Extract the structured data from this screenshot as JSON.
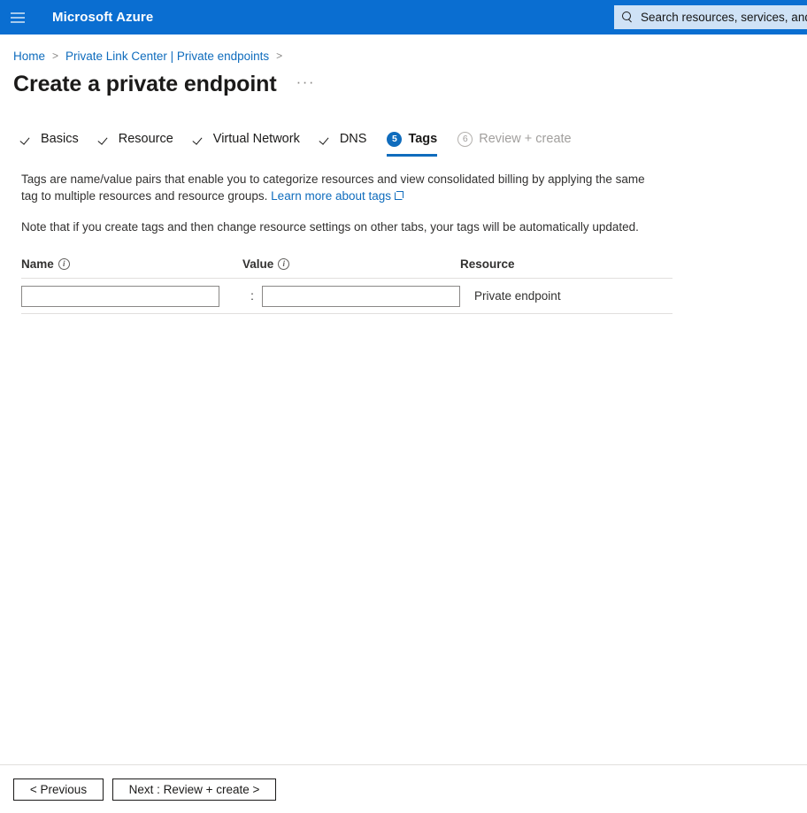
{
  "topbar": {
    "menu_icon": "hamburger-icon",
    "brand": "Microsoft Azure",
    "search": {
      "icon": "search-icon",
      "placeholder": "Search resources, services, and d",
      "value": ""
    }
  },
  "breadcrumb": {
    "items": [
      {
        "label": "Home"
      },
      {
        "label": "Private Link Center | Private endpoints"
      }
    ],
    "separator": ">"
  },
  "page": {
    "title": "Create a private endpoint",
    "more_actions": "···"
  },
  "tabs": [
    {
      "label": "Basics",
      "state": "completed",
      "marker": "check"
    },
    {
      "label": "Resource",
      "state": "completed",
      "marker": "check"
    },
    {
      "label": "Virtual Network",
      "state": "completed",
      "marker": "check"
    },
    {
      "label": "DNS",
      "state": "completed",
      "marker": "check"
    },
    {
      "label": "Tags",
      "state": "active",
      "marker": "5"
    },
    {
      "label": "Review + create",
      "state": "disabled",
      "marker": "6"
    }
  ],
  "description": {
    "line1_before": "Tags are name/value pairs that enable you to categorize resources and view consolidated billing by applying the same tag to multiple resources and resource groups.",
    "learn_more": "Learn more about tags",
    "learn_more_icon": "external-link-icon",
    "note": "Note that if you create tags and then change resource settings on other tabs, your tags will be automatically updated."
  },
  "tags_table": {
    "columns": [
      {
        "label": "Name",
        "info_icon": "info-icon"
      },
      {
        "label": "Value",
        "info_icon": "info-icon"
      },
      {
        "label": "Resource",
        "info_icon": ""
      }
    ],
    "separator": ":",
    "rows": [
      {
        "name_value": "",
        "name_placeholder": "",
        "value_value": "",
        "value_placeholder": "",
        "resource": "Private endpoint"
      }
    ]
  },
  "footer": {
    "previous_label": "< Previous",
    "next_label": "Next : Review + create >"
  },
  "colors": {
    "azure_blue": "#0a6ed1",
    "link_blue": "#0f6cbd",
    "search_bg": "#cfe2f6",
    "text": "#323130",
    "disabled_text": "#a19f9d",
    "border": "#e1dfdd"
  }
}
